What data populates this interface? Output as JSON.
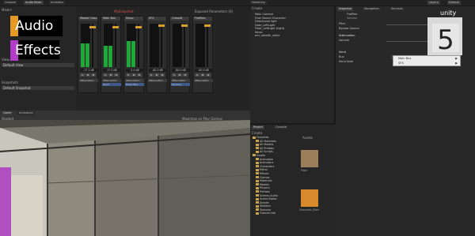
{
  "top_tabs": [
    {
      "label": "Console",
      "active": false
    },
    {
      "label": "Audio Mixer",
      "active": true
    },
    {
      "label": "Animator",
      "active": false
    }
  ],
  "account": {
    "label": "Layers",
    "layout": "Default"
  },
  "mixer": {
    "snapshot_bar": "MySnapshot",
    "exposed": "Exposed Parameters (0)",
    "sections": {
      "mixers_label": "Mixers",
      "views_label": "Views",
      "default_view": "Default View",
      "snapshots_label": "Snapshots",
      "default_snapshot": "Default Snapshot"
    },
    "channels": [
      {
        "name": "Master Group",
        "db": "-17.1 dB",
        "fx": [
          "Attenuation"
        ],
        "meter": 0.55
      },
      {
        "name": "Main Bus",
        "db": "-17.0 dB",
        "fx": [
          "Attenuation",
          "Send"
        ],
        "meter": 0.5
      },
      {
        "name": "Music",
        "db": "-5.0 dB",
        "fx": [
          "Attenuation",
          "Music Bus"
        ],
        "meter": 0.6
      },
      {
        "name": "SFX",
        "db": "-80.0 dB",
        "fx": [
          "Attenuation"
        ],
        "meter": 0.0
      },
      {
        "name": "Crossfd",
        "db": "-80.0 dB",
        "fx": [
          "Attenuation",
          "Receive"
        ],
        "meter": 0.0
      },
      {
        "name": "Fireflies",
        "db": "-80.0 dB",
        "fx": [
          "Attenuation"
        ],
        "meter": 0.0
      }
    ]
  },
  "hierarchy": {
    "title": "Hierarchy",
    "create": "Create",
    "items": [
      "Main Camera",
      "Fixer Bound Character",
      "Directional light",
      "Door_LeftLight",
      "Floor_LeftLight (light)",
      "Music",
      "env_stealth_static"
    ]
  },
  "inspector": {
    "tabs": [
      "Inspector",
      "Navigation",
      "Services"
    ],
    "object": "Fireflies",
    "sub": "Volume",
    "rows": [
      "Pitch",
      "Bypass Source",
      "Attenuation",
      "Volume",
      "Send",
      "Bus",
      "Send level"
    ],
    "bus_value": "None",
    "menu": [
      {
        "label": "Main Bus",
        "arrow": true
      },
      {
        "label": "SFX",
        "arrow": true
      }
    ]
  },
  "scene": {
    "tabs": [
      "Game",
      "Animation"
    ],
    "toolbar": "Shaded",
    "gizmos": "Maximize on Play Gizmos"
  },
  "project": {
    "tabs": [
      "Project",
      "Console"
    ],
    "create": "Create",
    "favorites": "Favorites",
    "fav_items": [
      "All Materials",
      "All Models",
      "All Prefabs",
      "All Scripts"
    ],
    "assets": "Assets",
    "folders": [
      "Animation",
      "Animators",
      "Characters",
      "Editor",
      "Effects",
      "Gizmos",
      "Materials",
      "Models",
      "Physics",
      "Prefabs",
      "Scenes Audio",
      "Scene Bakes",
      "Scripts",
      "Shaders",
      "Textures",
      "Tutorial Info"
    ],
    "breadcrumb": "Assets",
    "asset_labels": [
      "Floor",
      "Character_Elem"
    ]
  },
  "brand": {
    "audio": "Audio",
    "effects": "Effects",
    "version": "5"
  },
  "colors": {
    "meter_green": "#1fa83a",
    "knob": "#d8a02a",
    "audio_accent": "#e49a23",
    "effects_accent": "#b23cc8",
    "selection": "#3e5a8a"
  }
}
